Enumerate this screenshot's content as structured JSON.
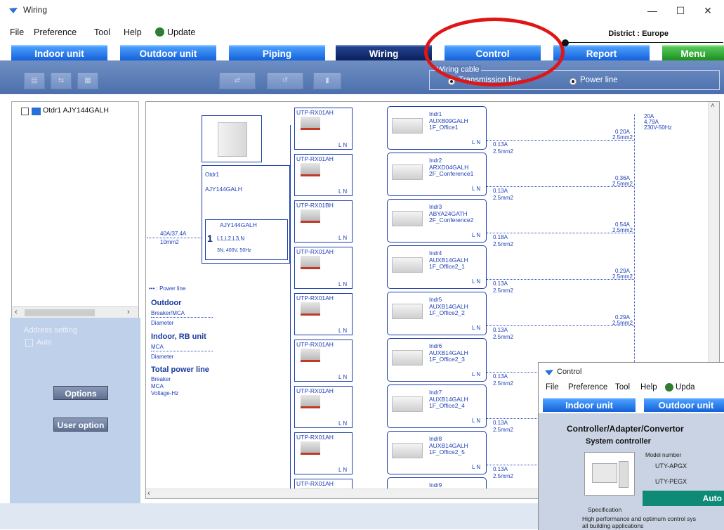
{
  "window": {
    "title": "Wiring",
    "min": "—",
    "max": "☐",
    "close": "✕"
  },
  "menu": {
    "items": [
      "File",
      "Preference",
      "Tool",
      "Help",
      "Update"
    ],
    "district": "District : Europe"
  },
  "tabs": [
    "Indoor unit",
    "Outdoor unit",
    "Piping",
    "Wiring",
    "Control",
    "Report",
    "Menu"
  ],
  "cable": {
    "legend": "Wiring cable",
    "transmission": "Transmission line",
    "power": "Power line"
  },
  "tree": {
    "item": "Otdr1 AJY144GALH"
  },
  "address": {
    "label": "Address setting",
    "auto": "Auto"
  },
  "buttons": {
    "options": "Options",
    "user_option": "User option"
  },
  "outdoor": {
    "name": "Otdr1",
    "model": "AJY144GALH",
    "inner_model": "AJY144GALH",
    "num": "1",
    "terminals": "L1,L2,L3,N",
    "power": "3N, 400V, 50Hz",
    "breaker": "40A/37.4A",
    "diameter": "10mm2"
  },
  "legend": {
    "power_line": "••• : Power line",
    "outdoor_title": "Outdoor",
    "outdoor_a": "Breaker/MCA",
    "outdoor_b": "Diameter",
    "indoor_title": "Indoor, RB unit",
    "indoor_a": "MCA",
    "indoor_b": "Diameter",
    "total_title": "Total power line",
    "total_a": "Breaker",
    "total_b": "MCA",
    "total_c": "Voltage-Hz"
  },
  "total": {
    "breaker": "20A",
    "mca": "4.79A",
    "voltage": "230V-50Hz"
  },
  "rows": [
    {
      "adapter": "UTP-RX01AH",
      "name": "Indr1",
      "model": "AUXB09GALH",
      "room": "1F_Office1",
      "mca": "0.13A",
      "dia": "2.5mm2",
      "right_a": "0.20A",
      "right_b": "2.5mm2"
    },
    {
      "adapter": "UTP-RX01AH",
      "name": "Indr2",
      "model": "ARXD04GALH",
      "room": "2F_Conference1",
      "mca": "0.13A",
      "dia": "2.5mm2",
      "right_a": "0.36A",
      "right_b": "2.5mm2"
    },
    {
      "adapter": "UTP-RX01BH",
      "name": "Indr3",
      "model": "ABYA24GATH",
      "room": "2F_Conference2",
      "mca": "0.18A",
      "dia": "2.5mm2",
      "right_a": "0.54A",
      "right_b": "2.5mm2"
    },
    {
      "adapter": "UTP-RX01AH",
      "name": "Indr4",
      "model": "AUXB14GALH",
      "room": "1F_Office2_1",
      "mca": "0.13A",
      "dia": "2.5mm2",
      "right_a": "0.29A",
      "right_b": "2.5mm2"
    },
    {
      "adapter": "UTP-RX01AH",
      "name": "Indr5",
      "model": "AUXB14GALH",
      "room": "1F_Office2_2",
      "mca": "0.13A",
      "dia": "2.5mm2",
      "right_a": "0.29A",
      "right_b": "2.5mm2"
    },
    {
      "adapter": "UTP-RX01AH",
      "name": "Indr6",
      "model": "AUXB14GALH",
      "room": "1F_Office2_3",
      "mca": "0.13A",
      "dia": "2.5mm2",
      "right_a": "",
      "right_b": ""
    },
    {
      "adapter": "UTP-RX01AH",
      "name": "Indr7",
      "model": "AUXB14GALH",
      "room": "1F_Office2_4",
      "mca": "0.13A",
      "dia": "2.5mm2",
      "right_a": "",
      "right_b": ""
    },
    {
      "adapter": "UTP-RX01AH",
      "name": "Indr8",
      "model": "AUXB14GALH",
      "room": "1F_Office2_5",
      "mca": "0.13A",
      "dia": "2.5mm2",
      "right_a": "",
      "right_b": ""
    },
    {
      "adapter": "UTP-RX01AH",
      "name": "Indr9",
      "model": "",
      "room": "",
      "mca": "",
      "dia": "",
      "right_a": "",
      "right_b": ""
    }
  ],
  "terminal_ln": "L N",
  "control": {
    "title": "Control",
    "menu": [
      "File",
      "Preference",
      "Tool",
      "Help",
      "Upda"
    ],
    "tabs": [
      "Indoor unit",
      "Outdoor unit"
    ],
    "section": "Controller/Adapter/Convertor",
    "subsection": "System controller",
    "model_label": "Model number",
    "models": [
      "UTY-APGX",
      "UTY-PEGX"
    ],
    "auto": "Auto",
    "spec_label": "Specification",
    "spec_text": "High performance and optimum control sys",
    "spec_text2": "all building applications"
  },
  "colors": {
    "tab_blue": "#1560d8",
    "tab_active": "#0a1f5e",
    "menu_green": "#1d8f22",
    "annotation": "#e01515"
  }
}
